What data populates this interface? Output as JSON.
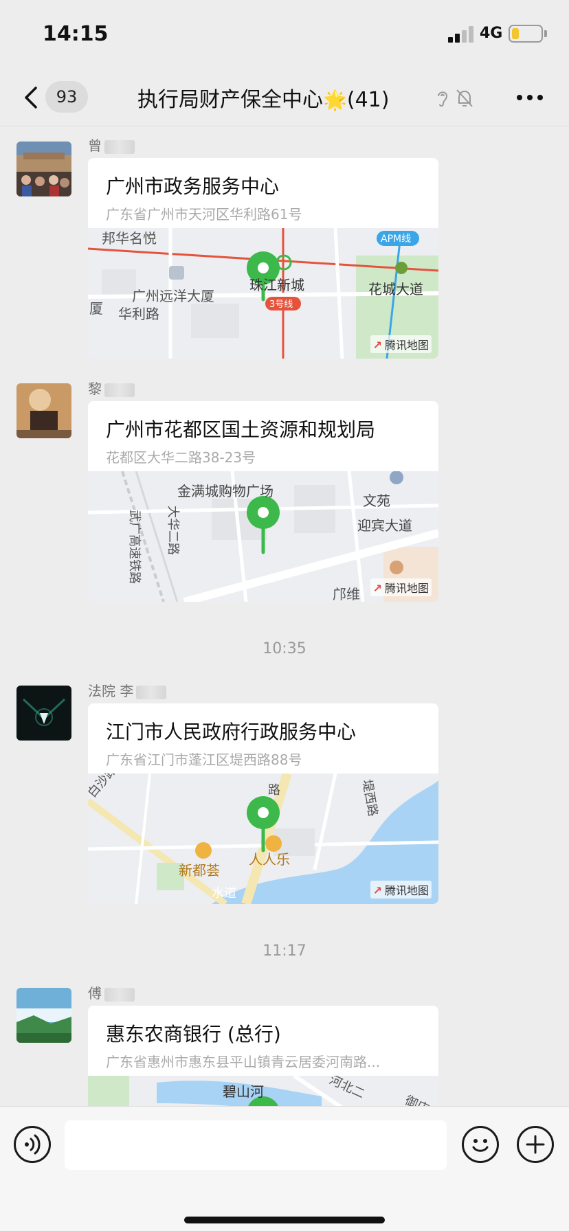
{
  "status_bar": {
    "time": "14:15",
    "network": "4G"
  },
  "nav": {
    "back_count": "93",
    "title": "执行局财产保全中心",
    "title_emoji": "🌟",
    "member_count": "(41)"
  },
  "messages": [
    {
      "sender": "曾",
      "title": "广州市政务服务中心",
      "address": "广东省广州市天河区华利路61号",
      "map": {
        "labels": [
          "邦华名悦",
          "广州远洋大厦",
          "华利路",
          "厦",
          "珠江新城",
          "3号线",
          "花城大道",
          "APM线"
        ],
        "provider": "腾讯地图"
      }
    },
    {
      "sender": "黎",
      "title": "广州市花都区国土资源和规划局",
      "address": "花都区大华二路38-23号",
      "map": {
        "labels": [
          "金满城购物广场",
          "文苑",
          "迎宾大道",
          "武广高速铁路",
          "大华二路",
          "邝维"
        ],
        "provider": "腾讯地图"
      }
    },
    {
      "timestamp_before": "10:35",
      "sender": "法院 李",
      "title": "江门市人民政府行政服务中心",
      "address": "广东省江门市蓬江区堤西路88号",
      "map": {
        "labels": [
          "白沙路",
          "堤西路",
          "新都荟",
          "人人乐",
          "路",
          "水道"
        ],
        "provider": "腾讯地图"
      }
    },
    {
      "timestamp_before": "11:17",
      "sender": "傅",
      "title": "惠东农商银行 (总行)",
      "address": "广东省惠州市惠东县平山镇青云居委河南路...",
      "map": {
        "labels": [
          "碧山河",
          "河北二",
          "御店"
        ],
        "provider": ""
      }
    }
  ],
  "colors": {
    "background": "#ededed",
    "pin_green": "#3cb94a",
    "metro_line_red": "#e5533d",
    "apm_blue": "#3aa6e8",
    "water_blue": "#a9d3f5"
  },
  "icons": [
    "back-chevron-icon",
    "ear-icon",
    "mute-bell-icon",
    "more-dots-icon",
    "voice-icon",
    "emoji-icon",
    "plus-icon",
    "location-pin-icon"
  ]
}
